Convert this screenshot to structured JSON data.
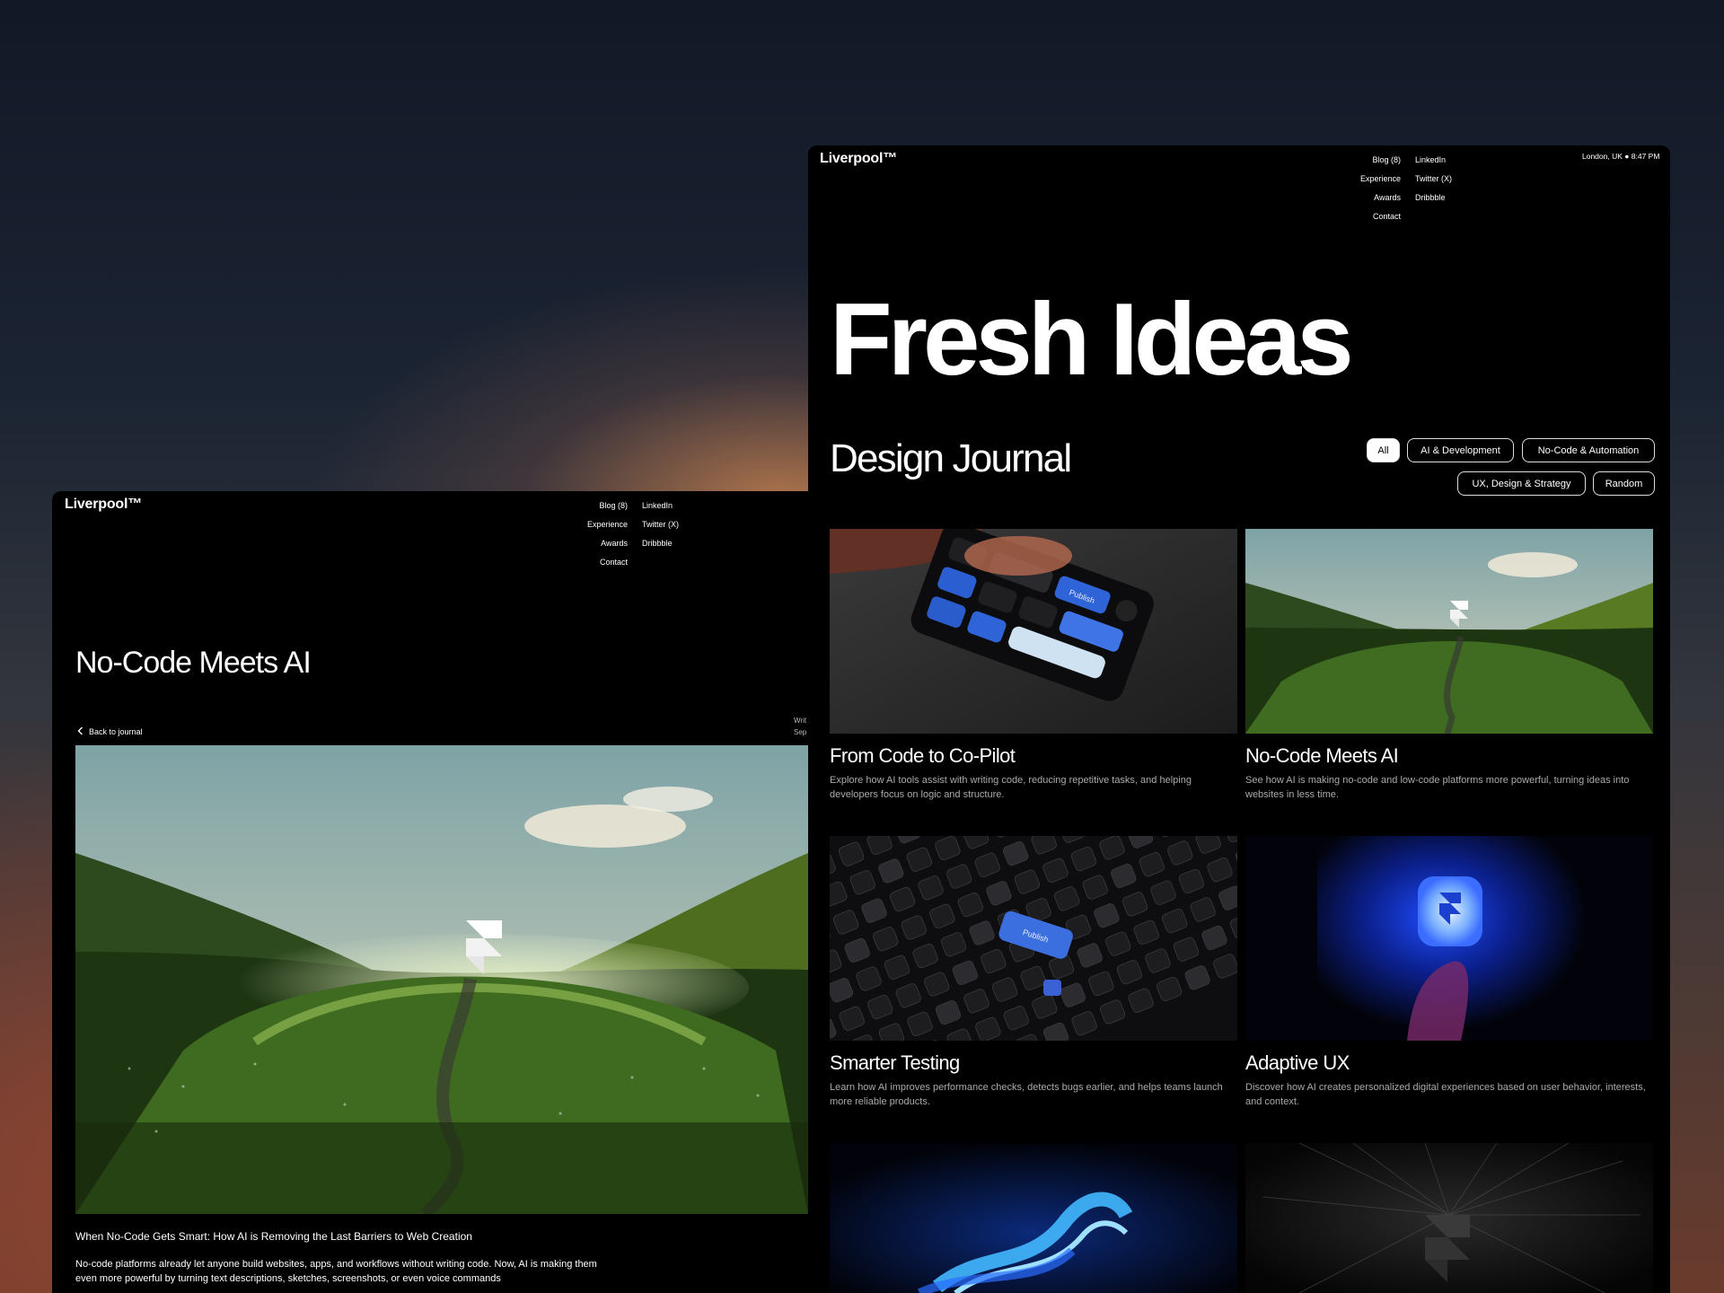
{
  "brand": "Liverpool™",
  "nav": {
    "primary": [
      "Blog (8)",
      "Experience",
      "Awards",
      "Contact"
    ],
    "social": [
      "LinkedIn",
      "Twitter (X)",
      "Dribbble"
    ]
  },
  "clock": "London, UK ● 8:47 PM",
  "left_page": {
    "post_title": "No-Code Meets AI",
    "back_label": "Back to journal",
    "meta_lines": [
      "Writ",
      "Sep"
    ],
    "article_heading": "When No-Code Gets Smart: How AI is Removing the Last Barriers to Web Creation",
    "article_paragraph": "No-code platforms already let anyone build websites, apps, and workflows without writing code. Now, AI is making them even more powerful by turning text descriptions, sketches, screenshots, or even voice commands"
  },
  "right_page": {
    "hero_title": "Fresh Ideas",
    "subtitle": "Design Journal",
    "filters": [
      {
        "label": "All",
        "active": true
      },
      {
        "label": "AI & Development",
        "active": false
      },
      {
        "label": "No-Code & Automation",
        "active": false
      },
      {
        "label": "UX, Design & Strategy",
        "active": false
      },
      {
        "label": "Random",
        "active": false
      }
    ],
    "cards": [
      {
        "title": "From Code to Co-Pilot",
        "desc": "Explore how AI tools assist with writing code, reducing repetitive tasks, and helping developers focus on logic and structure.",
        "image": "keypad-image"
      },
      {
        "title": "No-Code Meets AI",
        "desc": "See how AI is making no-code and low-code platforms more powerful, turning ideas into websites in less time.",
        "image": "meadow-image"
      },
      {
        "title": "Smarter Testing",
        "desc": "Learn how AI improves performance checks, detects bugs earlier, and helps teams launch more reliable products.",
        "image": "keyboard-image"
      },
      {
        "title": "Adaptive UX",
        "desc": "Discover how AI creates personalized digital experiences based on user behavior, interests, and context.",
        "image": "glowing-logo-image"
      },
      {
        "title": "",
        "desc": "",
        "image": "blue-wave-image"
      },
      {
        "title": "",
        "desc": "",
        "image": "dark-logo-image"
      }
    ],
    "thumb_labels": {
      "keypad_key": "Publish",
      "keyboard_key": "Publish"
    }
  },
  "colors": {
    "page_bg": "#000000",
    "text": "#ffffff",
    "muted": "#aaaaaa",
    "accent_blue": "#2f6bff"
  }
}
